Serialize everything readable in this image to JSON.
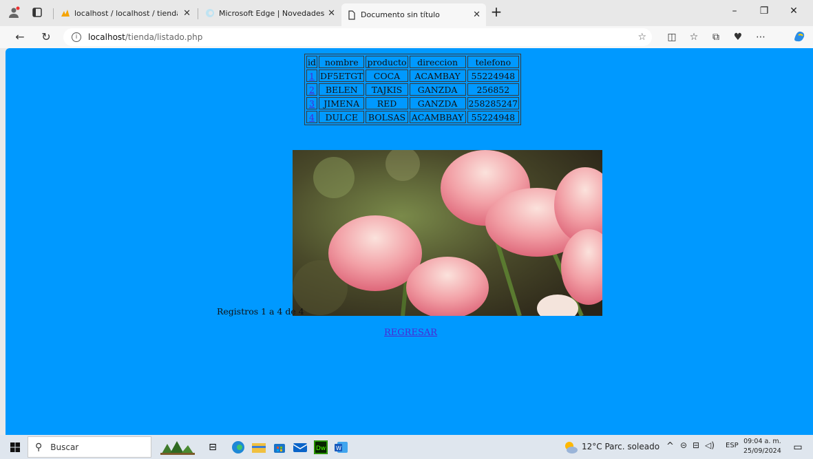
{
  "browser": {
    "tabs": [
      {
        "title": "localhost / localhost / tienda_aba",
        "active": false
      },
      {
        "title": "Microsoft Edge | Novedades",
        "active": false
      },
      {
        "title": "Documento sin título",
        "active": true
      }
    ],
    "new_tab_label": "+",
    "address": {
      "host": "localhost",
      "path": "/tienda/listado.php"
    },
    "window_controls": {
      "minimize": "–",
      "restore": "❐",
      "close": "✕"
    }
  },
  "page": {
    "table": {
      "headers": [
        "id",
        "nombre",
        "producto",
        "direccion",
        "telefono"
      ],
      "rows": [
        {
          "id": "1",
          "nombre": "DF5ETGT",
          "producto": "COCA",
          "direccion": "ACAMBAY",
          "telefono": "55224948"
        },
        {
          "id": "2",
          "nombre": "BELEN",
          "producto": "TAJKIS",
          "direccion": "GANZDA",
          "telefono": "256852"
        },
        {
          "id": "3",
          "nombre": "JIMENA",
          "producto": "RED",
          "direccion": "GANZDA",
          "telefono": "258285247"
        },
        {
          "id": "4",
          "nombre": "DULCE",
          "producto": "BOLSAS",
          "direccion": "ACAMBBAY",
          "telefono": "55224948"
        }
      ]
    },
    "records_caption": "Registros 1 a 4 de 4",
    "back_link": "REGRESAR",
    "background_color": "#0099ff"
  },
  "taskbar": {
    "search_placeholder": "Buscar",
    "weather": "12°C  Parc. soleado",
    "language": "ESP",
    "time": "09:04 a. m.",
    "date": "25/09/2024"
  }
}
